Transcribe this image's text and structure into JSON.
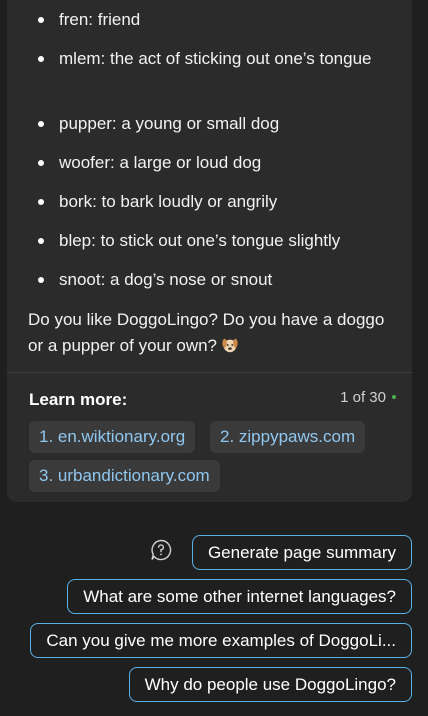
{
  "glossary": [
    {
      "text": "fren: friend"
    },
    {
      "text": "mlem: the act of sticking out one’s tongue"
    },
    {
      "text": "pupper: a young or small dog"
    },
    {
      "text": "woofer: a large or loud dog"
    },
    {
      "text": "bork: to bark loudly or angrily"
    },
    {
      "text": "blep: to stick out one’s tongue slightly"
    },
    {
      "text": "snoot: a dog’s nose or snout"
    }
  ],
  "closing_text": "Do you like DoggoLingo? Do you have a doggo or a pupper of your own?",
  "closing_emoji": "dog-face-emoji",
  "learn_more": {
    "title": "Learn more:",
    "counter": "1 of 30",
    "links": [
      {
        "label": "1. en.wiktionary.org"
      },
      {
        "label": "2. zippypaws.com"
      },
      {
        "label": "3. urbandictionary.com"
      }
    ]
  },
  "suggestions": [
    {
      "label": "Generate page summary"
    },
    {
      "label": "What are some other internet languages?"
    },
    {
      "label": "Can you give me more examples of DoggoLi..."
    },
    {
      "label": "Why do people use DoggoLingo?"
    }
  ],
  "colors": {
    "background": "#1f1f1f",
    "card": "#2b2b2b",
    "link": "#8fc7f0",
    "suggestion_border": "#5ab0e6",
    "status_dot": "#4caf50"
  }
}
